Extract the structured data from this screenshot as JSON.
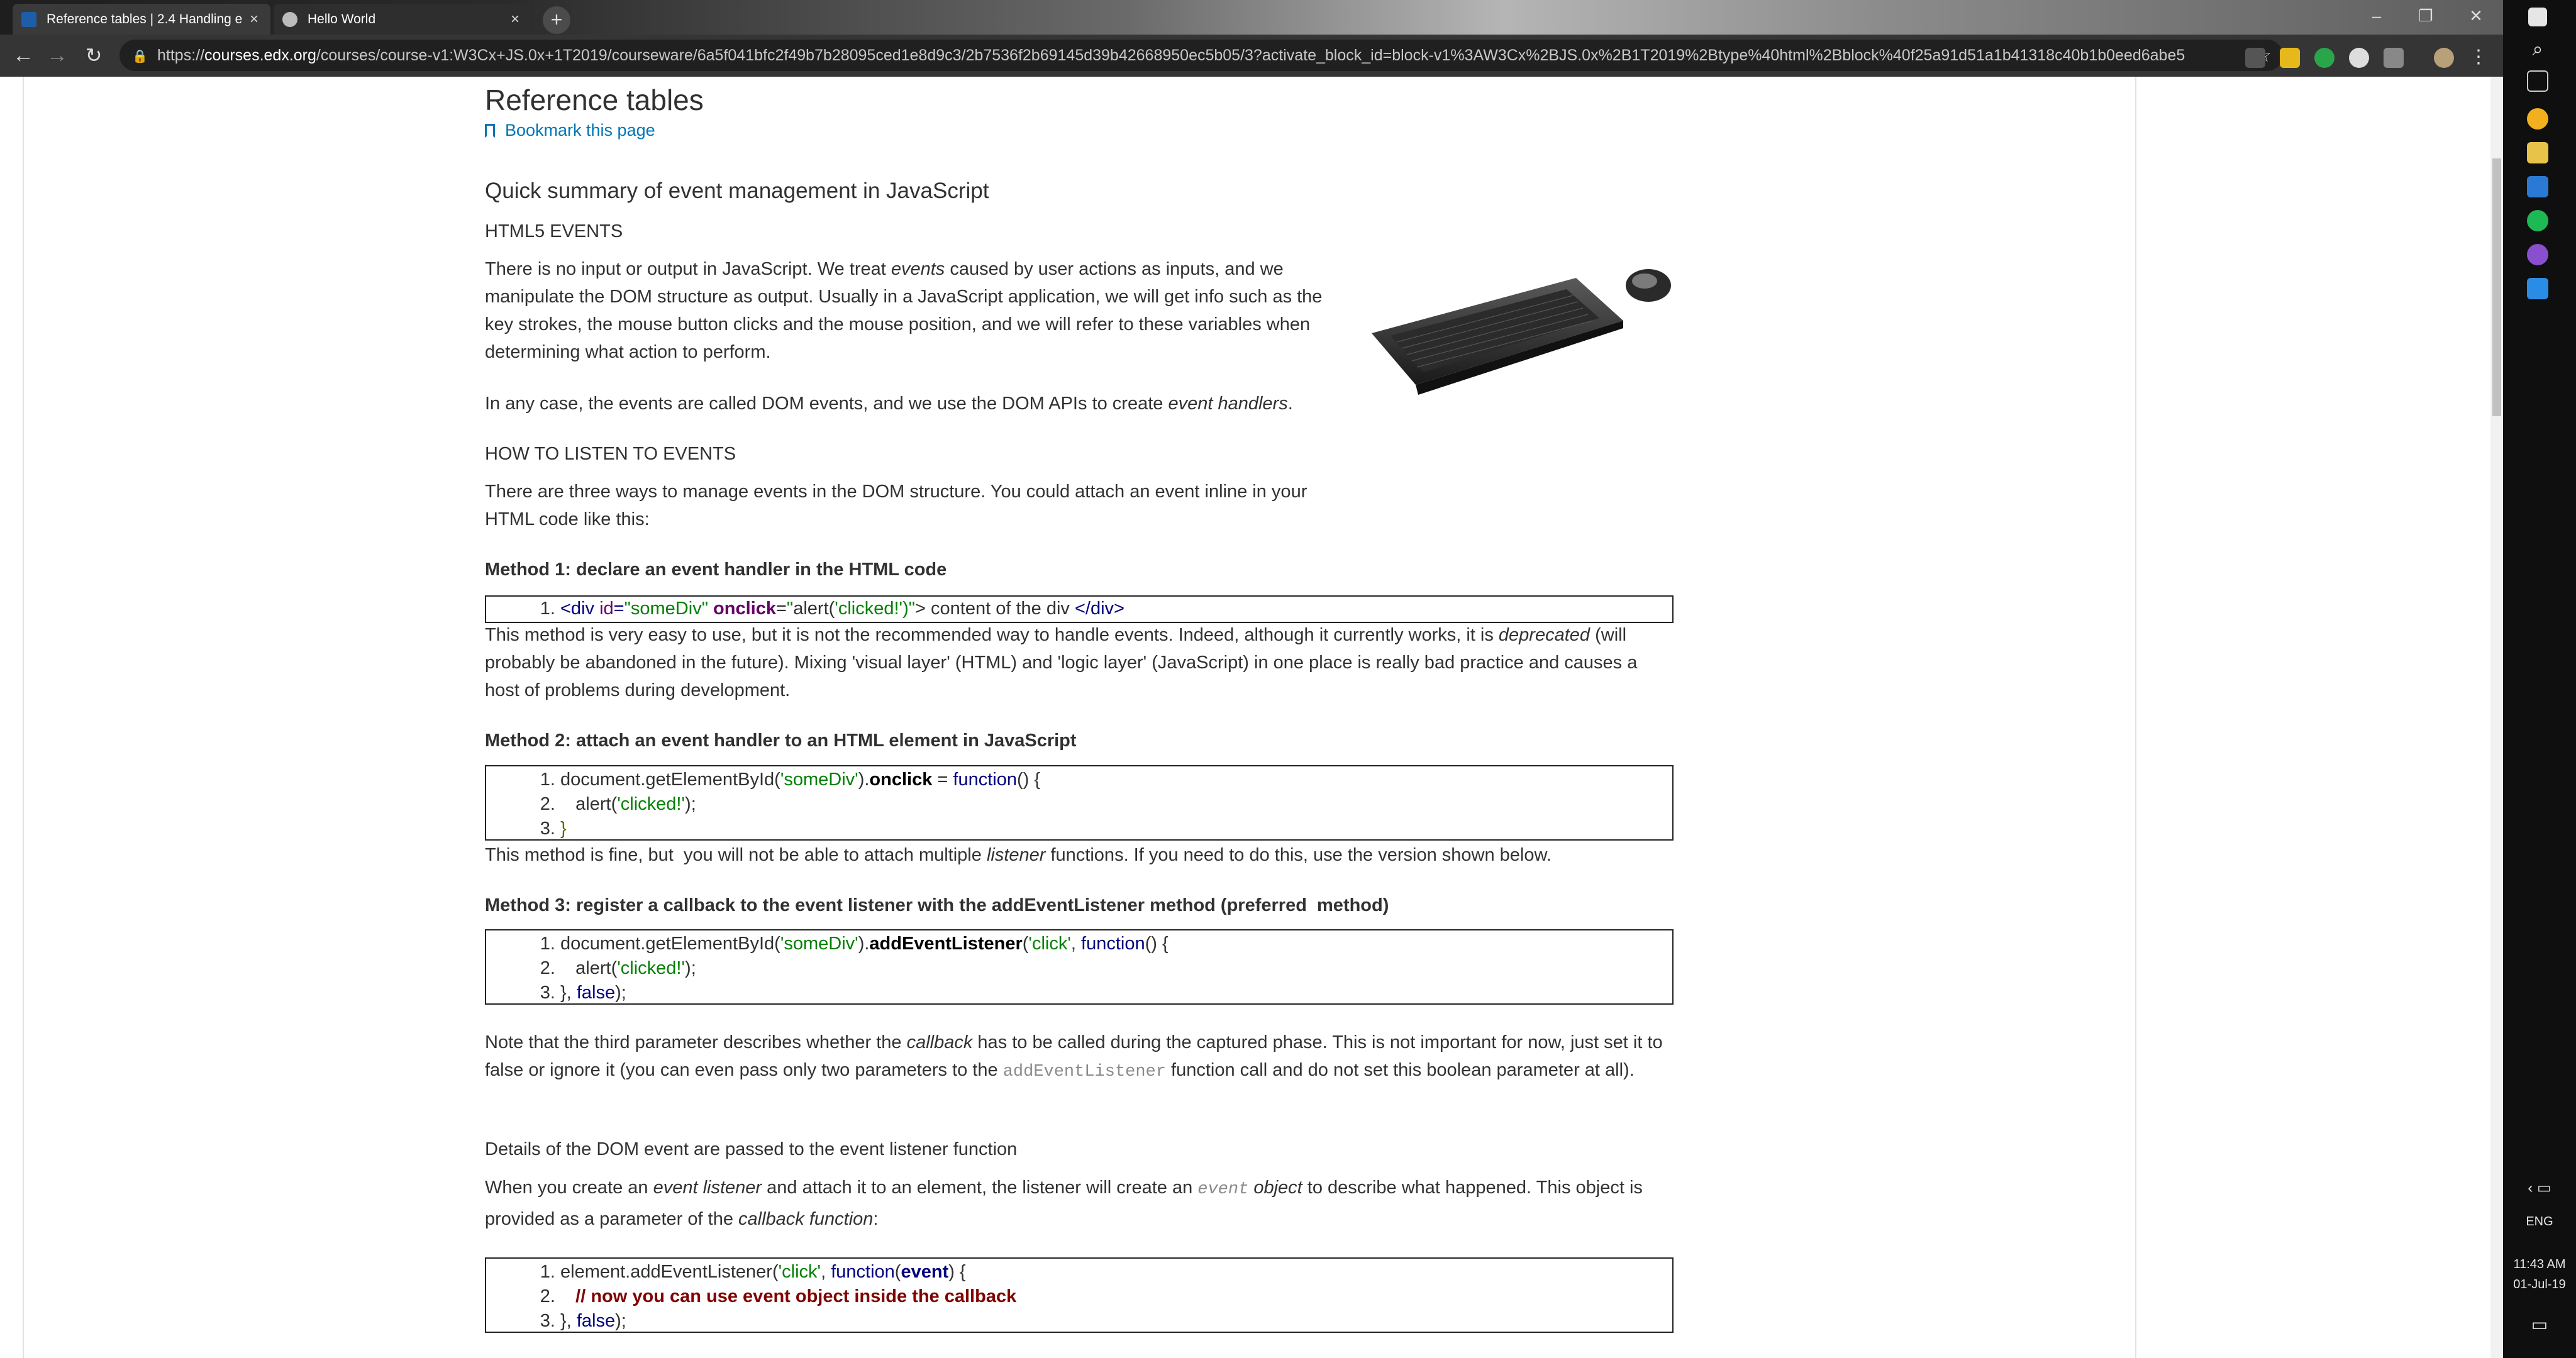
{
  "browser": {
    "tabs": [
      {
        "title": "Reference tables | 2.4 Handling e",
        "active": true
      },
      {
        "title": "Hello World",
        "active": false
      }
    ],
    "url_prefix": "https://",
    "url_host": "courses.edx.org",
    "url_path": "/courses/course-v1:W3Cx+JS.0x+1T2019/courseware/6a5f041bfc2f49b7b28095ced1e8d9c3/2b7536f2b69145d39b42668950ec5b05/3?activate_block_id=block-v1%3AW3Cx%2BJS.0x%2B1T2019%2Btype%40html%2Bblock%40f25a91d51a1b41318c40b1b0eed6abe5"
  },
  "page": {
    "title": "Reference tables",
    "bookmark_label": "Bookmark this page",
    "section_title": "Quick summary of event management in JavaScript",
    "html5_events_heading": "HTML5 EVENTS",
    "intro_p1": {
      "a": "There is no input or output in JavaScript. We treat ",
      "em": "events",
      "b": " caused by user actions as inputs, and we manipulate the DOM structure as output. Usually in a JavaScript application, we will get info such as the key strokes, the mouse button clicks and the mouse position, and we will refer to these variables when determining what action to perform."
    },
    "intro_p2": {
      "a": "In any case, the events are called DOM events, and we use the DOM APIs to create ",
      "em": "event handlers",
      "b": "."
    },
    "listen_heading": "HOW TO LISTEN TO EVENTS",
    "listen_p": "There are three ways to manage events in the DOM structure. You could attach an event inline in your HTML code like this:",
    "method1_heading": "Method 1: declare an event handler in the HTML code",
    "method1_p": {
      "a": "This method is very easy to use, but it is not the recommended way to handle events. Indeed, although it currently works, it is ",
      "em": "deprecated",
      "b": " (will probably be abandoned in the future). Mixing 'visual layer' (HTML) and 'logic layer' (JavaScript) in one place is really bad practice and causes a host of problems during development."
    },
    "method2_heading": "Method 2: attach an event handler to an HTML element in JavaScript",
    "method2_p": {
      "a": "This method is fine, but  you will not be able to attach multiple ",
      "em": "listener",
      "b": " functions. If you need to do this, use the version shown below."
    },
    "method3_heading": "Method 3: register a callback to the event listener with the addEventListener method (preferred  method)",
    "note_p": {
      "a": "Note that the third parameter describes whether the ",
      "em": "callback",
      "b": " has to be called during the captured phase. This is not important for now, just set it to false or ignore it (you can even pass only two parameters to the ",
      "code": "addEventListener",
      "c": " function call and do not set this boolean parameter at all)."
    },
    "details_heading": "Details of the DOM event are passed to the event listener function",
    "details_p": {
      "a": "When you create an ",
      "em1": "event listener",
      "b": " and attach it to an element, the listener will create an ",
      "code": "event",
      "em2": " object",
      "c": " to describe what happened. This object is provided as a parameter of the ",
      "em3": "callback function",
      "d": ":"
    },
    "code1": {
      "l1_tag_open": "<div ",
      "l1_attr_id": "id",
      "l1_eq1": "=",
      "l1_val_id": "\"someDiv\"",
      "l1_sp": " ",
      "l1_onclick": "onclick",
      "l1_eq2": "=",
      "l1_q1": "\"",
      "l1_alert": "alert(",
      "l1_str": "'clicked!'",
      "l1_close": ")\"",
      "l1_gt": "> content of the div ",
      "l1_end": "</div>"
    },
    "code2": {
      "l1_a": "document.getElementById(",
      "l1_str": "'someDiv'",
      "l1_b": ").",
      "l1_bold": "onclick",
      "l1_c": " = ",
      "l1_kw": "function",
      "l1_d": "() {",
      "l2_a": "   alert(",
      "l2_str": "'clicked!'",
      "l2_b": ");",
      "l3": "}"
    },
    "code3": {
      "l1_a": "document.getElementById(",
      "l1_str": "'someDiv'",
      "l1_b": ").",
      "l1_bold": "addEventListener",
      "l1_c": "(",
      "l1_str2": "'click'",
      "l1_d": ", ",
      "l1_kw": "function",
      "l1_e": "() {",
      "l2_a": "   alert(",
      "l2_str": "'clicked!'",
      "l2_b": ");",
      "l3_a": "}, ",
      "l3_kw": "false",
      "l3_b": ");"
    },
    "code4": {
      "l1_a": "element.addEventListener(",
      "l1_str": "'click'",
      "l1_b": ", ",
      "l1_kw": "function",
      "l1_c": "(",
      "l1_bold": "event",
      "l1_d": ") {",
      "l2": "   // now you can use event object inside the callback",
      "l3_a": "}, ",
      "l3_kw": "false",
      "l3_b": ");"
    }
  },
  "taskbar": {
    "language": "ENG",
    "time": "11:43 AM",
    "date": "01-Jul-19"
  }
}
